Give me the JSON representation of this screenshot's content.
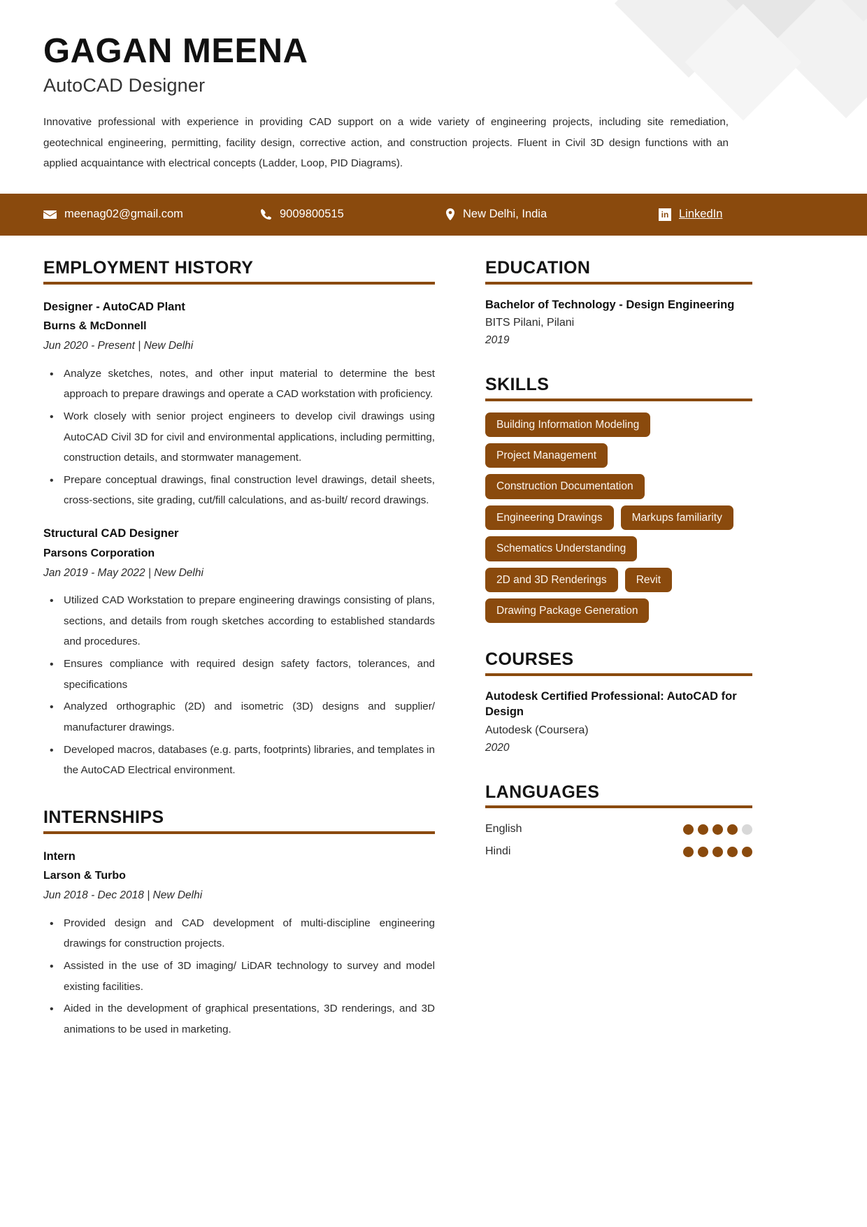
{
  "theme": {
    "accent": "#8a4a0d",
    "text": "#1a1a1a",
    "dot_empty": "#d8d8d8"
  },
  "header": {
    "name": "GAGAN MEENA",
    "role": "AutoCAD Designer",
    "summary": "Innovative professional with experience in providing CAD support on a wide variety of engineering projects, including site remediation, geotechnical engineering, permitting, facility design, corrective action, and construction projects. Fluent in Civil 3D design functions with an applied acquaintance with electrical concepts (Ladder, Loop, PID Diagrams)."
  },
  "contact": {
    "email": "meenag02@gmail.com",
    "phone": "9009800515",
    "location": "New Delhi, India",
    "linkedin": "LinkedIn",
    "icons": {
      "email": "envelope-icon",
      "phone": "phone-icon",
      "location": "map-pin-icon",
      "linkedin": "linkedin-icon"
    }
  },
  "employment": {
    "title": "EMPLOYMENT HISTORY",
    "jobs": [
      {
        "title": "Designer - AutoCAD Plant",
        "org": "Burns & McDonnell",
        "meta": "Jun 2020 - Present | New Delhi",
        "bullets": [
          "Analyze sketches, notes, and other input material to determine the best approach to prepare drawings and operate a CAD workstation with proficiency.",
          "Work closely with senior project engineers to develop civil drawings using AutoCAD Civil 3D for civil and environmental applications, including permitting, construction details, and stormwater management.",
          "Prepare conceptual drawings, final construction level drawings, detail sheets, cross-sections, site grading, cut/fill calculations, and as-built/ record drawings."
        ]
      },
      {
        "title": "Structural CAD Designer",
        "org": "Parsons Corporation",
        "meta": "Jan 2019 - May 2022 | New Delhi",
        "bullets": [
          "Utilized CAD Workstation to prepare engineering drawings consisting of plans, sections, and details from rough sketches according to established standards and procedures.",
          "Ensures compliance with required design safety factors, tolerances, and specifications",
          "Analyzed orthographic (2D) and isometric (3D) designs and supplier/ manufacturer drawings.",
          "Developed macros, databases (e.g. parts, footprints) libraries, and templates in the AutoCAD Electrical environment."
        ]
      }
    ]
  },
  "internships": {
    "title": "INTERNSHIPS",
    "jobs": [
      {
        "title": "Intern",
        "org": "Larson & Turbo",
        "meta": "Jun 2018 - Dec 2018 | New Delhi",
        "bullets": [
          "Provided design and CAD development of multi-discipline engineering drawings for construction projects.",
          "Assisted in the use of 3D imaging/ LiDAR technology to survey and model existing facilities.",
          "Aided in the development of graphical presentations, 3D renderings, and 3D animations to be used in marketing."
        ]
      }
    ]
  },
  "education": {
    "title": "EDUCATION",
    "entries": [
      {
        "degree": "Bachelor of Technology - Design Engineering",
        "school": "BITS Pilani, Pilani",
        "year": "2019"
      }
    ]
  },
  "skills": {
    "title": "SKILLS",
    "items": [
      "Building Information Modeling",
      "Project Management",
      "Construction Documentation",
      "Engineering Drawings",
      "Markups familiarity",
      "Schematics Understanding",
      "2D and 3D Renderings",
      "Revit",
      "Drawing Package Generation"
    ]
  },
  "courses": {
    "title": "COURSES",
    "entries": [
      {
        "name": "Autodesk Certified Professional: AutoCAD for Design",
        "provider": "Autodesk (Coursera)",
        "year": "2020"
      }
    ]
  },
  "languages": {
    "title": "LANGUAGES",
    "items": [
      {
        "name": "English",
        "level": 4,
        "max": 5
      },
      {
        "name": "Hindi",
        "level": 5,
        "max": 5
      }
    ]
  }
}
